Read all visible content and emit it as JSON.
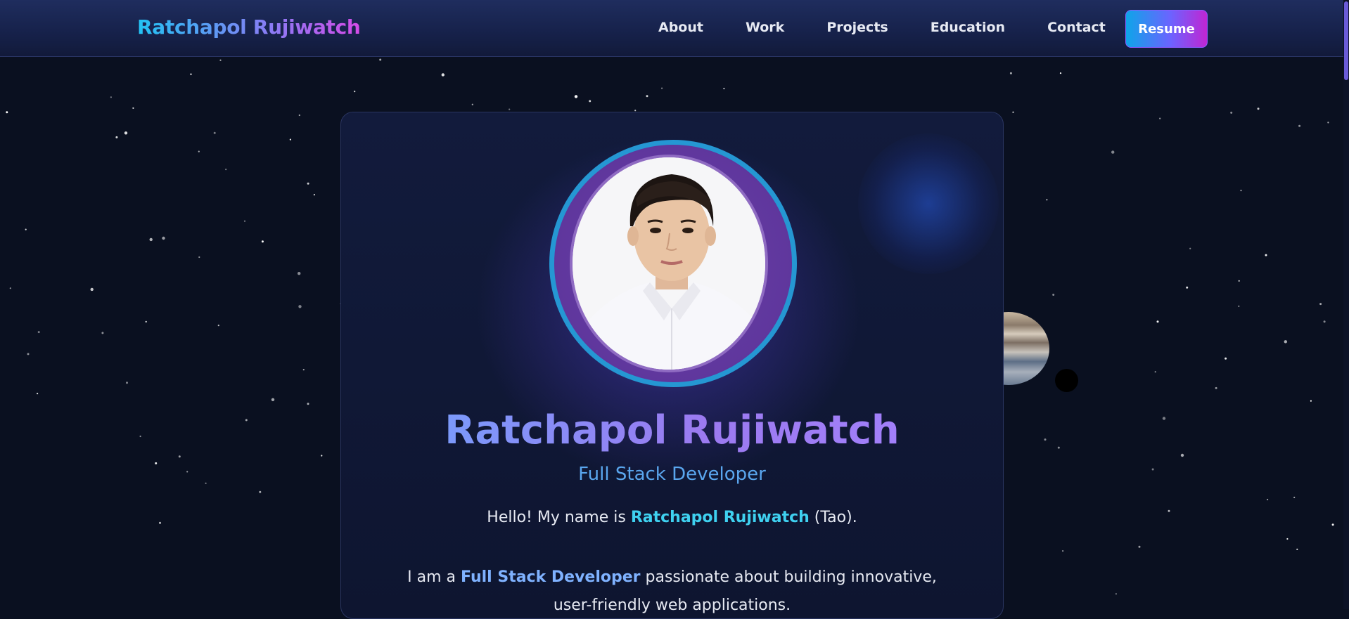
{
  "nav": {
    "brand": "Ratchapol Rujiwatch",
    "links": [
      "About",
      "Work",
      "Projects",
      "Education",
      "Contact"
    ],
    "resume_label": "Resume"
  },
  "hero": {
    "name": "Ratchapol Rujiwatch",
    "role": "Full Stack Developer",
    "intro_prefix": "Hello! My name is ",
    "intro_name": "Ratchapol Rujiwatch",
    "intro_suffix": " (Tao).",
    "para_prefix": "I am a ",
    "para_highlight": "Full Stack Developer",
    "para_suffix": " passionate about building innovative, user-friendly web applications."
  },
  "colors": {
    "background": "#0a1020",
    "nav_bg": "#16214a",
    "accent_cyan": "#22c3f3",
    "accent_purple": "#8b7bf5",
    "accent_magenta": "#d54be8",
    "role_blue": "#5aa6ee"
  }
}
